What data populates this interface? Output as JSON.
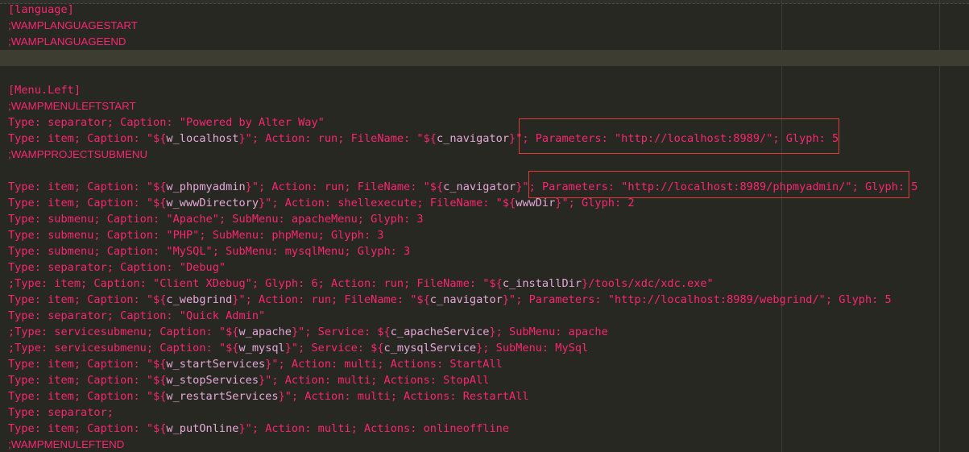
{
  "editor": {
    "lines": [
      {
        "parts": [
          "[language]"
        ]
      },
      {
        "parts": [
          ";WAMPLANGUAGESTART"
        ],
        "comment": true
      },
      {
        "parts": [
          ";WAMPLANGUAGEEND"
        ],
        "comment": true
      },
      {
        "parts": [
          ""
        ],
        "current": true
      },
      {
        "parts": [
          ""
        ]
      },
      {
        "parts": [
          "[Menu.Left]"
        ]
      },
      {
        "parts": [
          ";WAMPMENULEFTSTART"
        ],
        "comment": true
      },
      {
        "parts": [
          "Type: separator; Caption: \"Powered by Alter Way\""
        ]
      },
      {
        "parts": [
          "Type: item; Caption: \"${",
          "w_localhost",
          "}\"; Action: run; FileName: \"${",
          "c_navigator",
          "}\"; Parameters: \"http://localhost:8989/\"; Glyph: 5"
        ]
      },
      {
        "parts": [
          ";WAMPPROJECTSUBMENU"
        ],
        "comment": true
      },
      {
        "parts": [
          ""
        ]
      },
      {
        "parts": [
          "Type: item; Caption: \"${",
          "w_phpmyadmin",
          "}\"; Action: run; FileName: \"${",
          "c_navigator",
          "}\"; Parameters: \"http://localhost:8989/phpmyadmin/\"; Glyph: 5"
        ]
      },
      {
        "parts": [
          "Type: item; Caption: \"${",
          "w_wwwDirectory",
          "}\"; Action: shellexecute; FileName: \"${",
          "wwwDir",
          "}\"; Glyph: 2"
        ]
      },
      {
        "parts": [
          "Type: submenu; Caption: \"Apache\"; SubMenu: apacheMenu; Glyph: 3"
        ]
      },
      {
        "parts": [
          "Type: submenu; Caption: \"PHP\"; SubMenu: phpMenu; Glyph: 3"
        ]
      },
      {
        "parts": [
          "Type: submenu; Caption: \"MySQL\"; SubMenu: mysqlMenu; Glyph: 3"
        ]
      },
      {
        "parts": [
          "Type: separator; Caption: \"Debug\""
        ]
      },
      {
        "parts": [
          ";Type: item; Caption: \"Client XDebug\"; Glyph: 6; Action: run; FileName: \"${",
          "c_installDir",
          "}/tools/xdc/xdc.exe\""
        ]
      },
      {
        "parts": [
          "Type: item; Caption: \"${",
          "c_webgrind",
          "}\"; Action: run; FileName: \"${",
          "c_navigator",
          "}\"; Parameters: \"http://localhost:8989/webgrind/\"; Glyph: 5"
        ]
      },
      {
        "parts": [
          "Type: separator; Caption: \"Quick Admin\""
        ]
      },
      {
        "parts": [
          ";Type: servicesubmenu; Caption: \"${",
          "w_apache",
          "}\"; Service: ${",
          "c_apacheService",
          "}; SubMenu: apache"
        ]
      },
      {
        "parts": [
          ";Type: servicesubmenu; Caption: \"${",
          "w_mysql",
          "}\"; Service: ${",
          "c_mysqlService",
          "}; SubMenu: MySql"
        ]
      },
      {
        "parts": [
          "Type: item; Caption: \"${",
          "w_startServices",
          "}\"; Action: multi; Actions: StartAll"
        ]
      },
      {
        "parts": [
          "Type: item; Caption: \"${",
          "w_stopServices",
          "}\"; Action: multi; Actions: StopAll"
        ]
      },
      {
        "parts": [
          "Type: item; Caption: \"${",
          "w_restartServices",
          "}\"; Action: multi; Actions: RestartAll"
        ]
      },
      {
        "parts": [
          "Type: separator;"
        ]
      },
      {
        "parts": [
          "Type: item; Caption: \"${",
          "w_putOnline",
          "}\"; Action: multi; Actions: onlineoffline"
        ]
      },
      {
        "parts": [
          ";WAMPMENULEFTEND"
        ],
        "comment": true
      }
    ]
  },
  "colors": {
    "background": "#272822",
    "text": "#f92672",
    "variable": "#e6a8d8",
    "current_line": "#3e3d32",
    "highlight_box": "#e03a3a"
  }
}
